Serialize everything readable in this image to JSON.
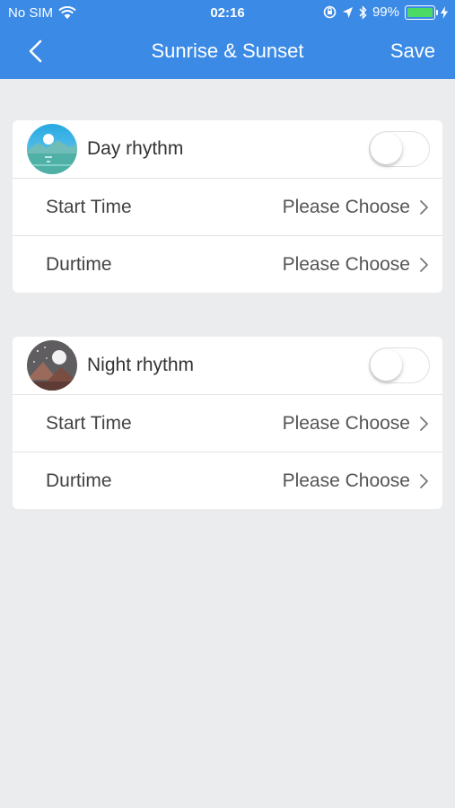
{
  "status": {
    "carrier": "No SIM",
    "time": "02:16",
    "battery": "99%",
    "battery_level": 0.99,
    "icons": [
      "wifi-icon",
      "lock-rotation-icon",
      "location-arrow-icon",
      "bluetooth-icon",
      "battery-icon",
      "charging-bolt-icon"
    ]
  },
  "nav": {
    "back_icon": "chevron-left-icon",
    "title": "Sunrise & Sunset",
    "save_label": "Save"
  },
  "day": {
    "title": "Day rhythm",
    "icon": "sunrise-landscape-icon",
    "enabled": false,
    "rows": [
      {
        "label": "Start Time",
        "value": "Please Choose"
      },
      {
        "label": "Durtime",
        "value": "Please Choose"
      }
    ]
  },
  "night": {
    "title": "Night rhythm",
    "icon": "night-moon-landscape-icon",
    "enabled": false,
    "rows": [
      {
        "label": "Start Time",
        "value": "Please Choose"
      },
      {
        "label": "Durtime",
        "value": "Please Choose"
      }
    ]
  },
  "colors": {
    "accent": "#3b8ae6",
    "background": "#ebecee",
    "battery": "#4cd964"
  }
}
